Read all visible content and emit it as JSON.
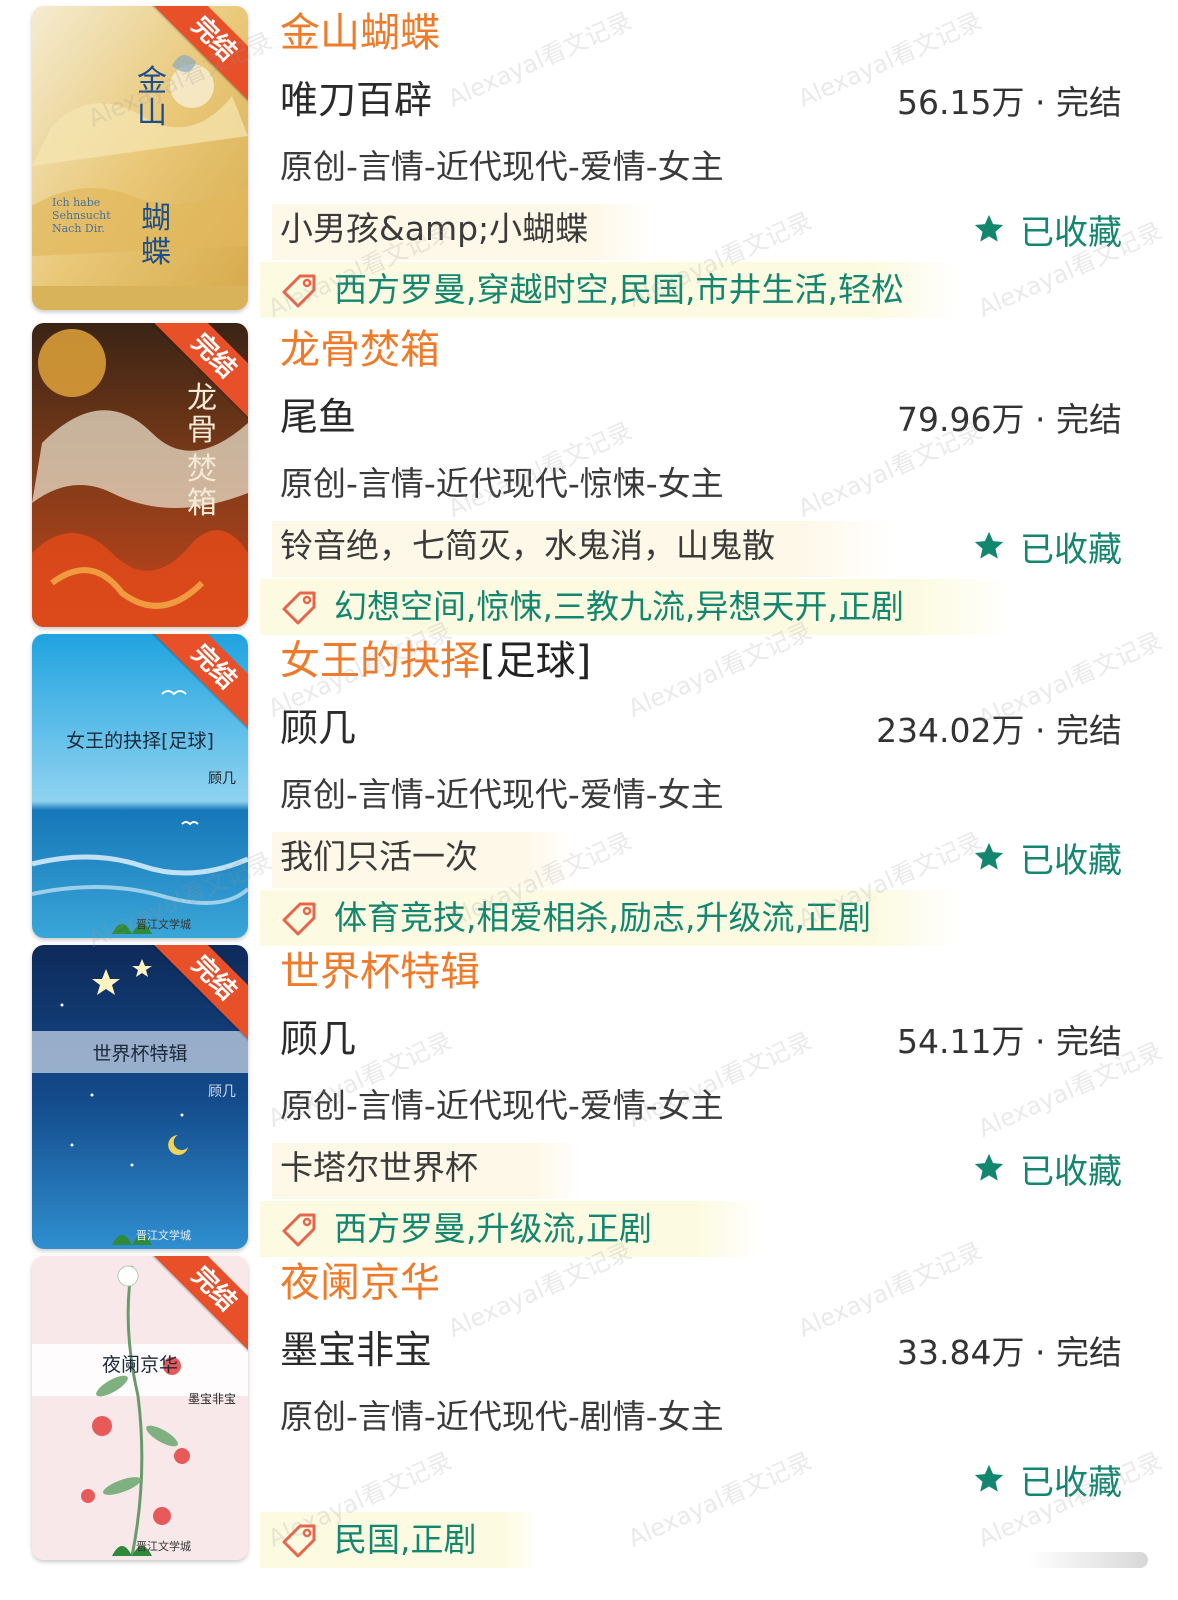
{
  "ribbon_label": "完结",
  "favorite_label": "已收藏",
  "watermark": "Alexayal看文记录",
  "colors": {
    "title": "#ef7b2a",
    "accent_green": "#13866f",
    "ribbon": "#e8502a"
  },
  "books": [
    {
      "title": "金山蝴蝶",
      "title_suffix": "",
      "author": "唯刀百辟",
      "word_count": "56.15万 · 完结",
      "category": "原创-言情-近代现代-爱情-女主",
      "summary": "小男孩&amp;小蝴蝶",
      "tags": "西方罗曼,穿越时空,民国,市井生活,轻松",
      "cover": {
        "style": "gold",
        "title_vertical_top": "金山",
        "title_vertical_bottom": "蝴蝶",
        "small_text": "Ich habe Sehnsucht Nach Dir."
      }
    },
    {
      "title": "龙骨焚箱",
      "title_suffix": "",
      "author": "尾鱼",
      "word_count": "79.96万 · 完结",
      "category": "原创-言情-近代现代-惊悚-女主",
      "summary": "铃音绝，七简灭，水鬼消，山鬼散",
      "tags": "幻想空间,惊悚,三教九流,异想天开,正剧",
      "cover": {
        "style": "fire",
        "title_vertical_top": "龙骨",
        "title_vertical_bottom": "焚箱"
      }
    },
    {
      "title": "女王的抉择",
      "title_suffix": "[足球]",
      "author": "顾几",
      "word_count": "234.02万 · 完结",
      "category": "原创-言情-近代现代-爱情-女主",
      "summary": "我们只活一次",
      "tags": "体育竞技,相爱相杀,励志,升级流,正剧",
      "cover": {
        "style": "sea",
        "title": "女王的抉择[足球]",
        "author": "顾几",
        "publisher": "晋江文学城"
      }
    },
    {
      "title": "世界杯特辑",
      "title_suffix": "",
      "author": "顾几",
      "word_count": "54.11万 · 完结",
      "category": "原创-言情-近代现代-爱情-女主",
      "summary": "卡塔尔世界杯",
      "tags": "西方罗曼,升级流,正剧",
      "cover": {
        "style": "night",
        "title": "世界杯特辑",
        "author": "顾几",
        "publisher": "晋江文学城"
      }
    },
    {
      "title": "夜阑京华",
      "title_suffix": "",
      "author": "墨宝非宝",
      "word_count": "33.84万 · 完结",
      "category": "原创-言情-近代现代-剧情-女主",
      "summary": "",
      "tags": "民国,正剧",
      "cover": {
        "style": "floral",
        "title": "夜阑京华",
        "author": "墨宝非宝",
        "publisher": "晋江文学城"
      }
    }
  ]
}
